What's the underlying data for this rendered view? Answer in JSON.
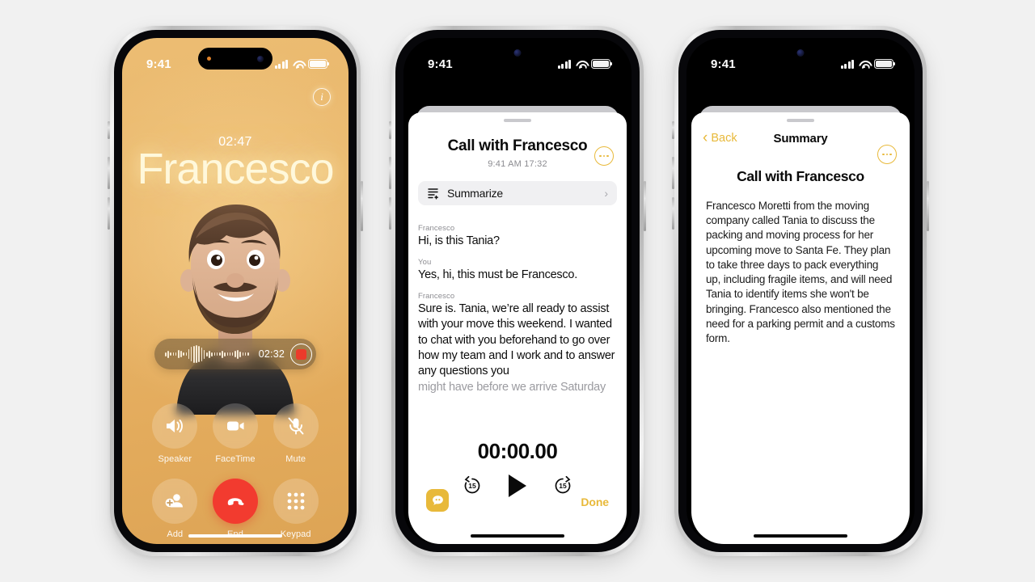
{
  "canvas": {
    "background": "#f1f1f1"
  },
  "accent": {
    "yellow": "#e8b93a",
    "red": "#f23b2f",
    "call_bg": "#e8b468"
  },
  "phone1": {
    "name": "call-screen",
    "statusbar": {
      "time": "9:41"
    },
    "info_icon": "i",
    "call_timer": "02:47",
    "caller_name": "Francesco",
    "recording": {
      "time": "02:32",
      "record_icon": "stop-record-icon"
    },
    "controls": [
      {
        "label": "Speaker",
        "icon": "speaker-icon",
        "name": "speaker-button"
      },
      {
        "label": "FaceTime",
        "icon": "video-camera-icon",
        "name": "facetime-button"
      },
      {
        "label": "Mute",
        "icon": "mic-slash-icon",
        "name": "mute-button"
      },
      {
        "label": "Add",
        "icon": "add-person-icon",
        "name": "add-button"
      },
      {
        "label": "End",
        "icon": "phone-down-icon",
        "name": "end-call-button"
      },
      {
        "label": "Keypad",
        "icon": "keypad-icon",
        "name": "keypad-button"
      }
    ]
  },
  "phone2": {
    "name": "call-recording-sheet",
    "statusbar": {
      "time": "9:41"
    },
    "title": "Call with Francesco",
    "subtitle": "9:41 AM  17:32",
    "more_icon": "ellipsis-circle-icon",
    "summarize": {
      "label": "Summarize",
      "icon": "summarize-icon",
      "chevron": "›"
    },
    "transcript": [
      {
        "speaker": "Francesco",
        "text": "Hi, is this Tania?",
        "faded": false
      },
      {
        "speaker": "You",
        "text": "Yes, hi, this must be Francesco.",
        "faded": false
      },
      {
        "speaker": "Francesco",
        "text": "Sure is. Tania, we’re all ready to assist with your move this weekend. I wanted to chat with you beforehand to go over how my team and I work and to answer any questions you",
        "faded": false
      },
      {
        "speaker": "",
        "text": "might have before we arrive Saturday",
        "faded": true
      }
    ],
    "player": {
      "time": "00:00.00",
      "back_label": "15",
      "forward_label": "15",
      "play_icon": "play-icon"
    },
    "messages_icon": "messages-bubble-icon",
    "done_label": "Done"
  },
  "phone3": {
    "name": "summary-screen",
    "statusbar": {
      "time": "9:41"
    },
    "back_label": "Back",
    "nav_title": "Summary",
    "more_icon": "ellipsis-circle-icon",
    "heading": "Call with Francesco",
    "body": "Francesco Moretti from the moving company called Tania to discuss the packing and moving process for her upcoming move to Santa Fe. They plan to take three days to pack everything up, including fragile items, and will need Tania to identify items she won't be bringing. Francesco also mentioned the need for a parking permit and a customs form."
  }
}
